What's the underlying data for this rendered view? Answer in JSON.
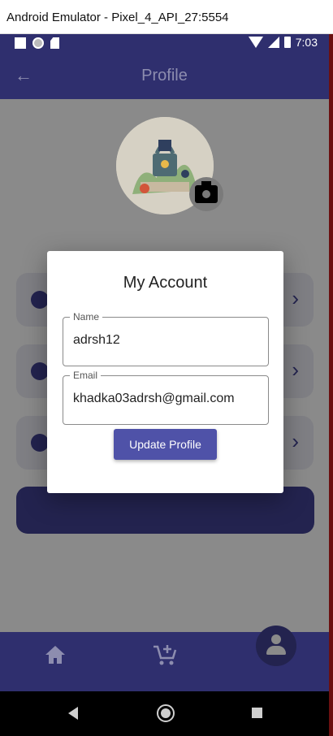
{
  "window": {
    "title": "Android Emulator - Pixel_4_API_27:5554"
  },
  "status_bar": {
    "time": "7:03"
  },
  "app_bar": {
    "title": "Profile",
    "back_icon": "arrow-back-icon"
  },
  "profile": {
    "avatar_icon": "profile-illustration",
    "camera_icon": "camera-icon"
  },
  "menu": {
    "items": [
      {
        "icon": "person-icon"
      },
      {
        "icon": "settings-icon"
      },
      {
        "icon": "info-icon"
      }
    ]
  },
  "dialog": {
    "title": "My Account",
    "name_label": "Name",
    "name_value": "adrsh12",
    "email_label": "Email",
    "email_value": "khadka03adrsh@gmail.com",
    "button_label": "Update Profile"
  },
  "bottom_nav": {
    "items": [
      "home-icon",
      "add-to-cart-icon",
      "person-icon"
    ]
  },
  "colors": {
    "primary": "#2f2f6e",
    "button": "#4f52a8",
    "dialog_bg": "#ffffff"
  }
}
